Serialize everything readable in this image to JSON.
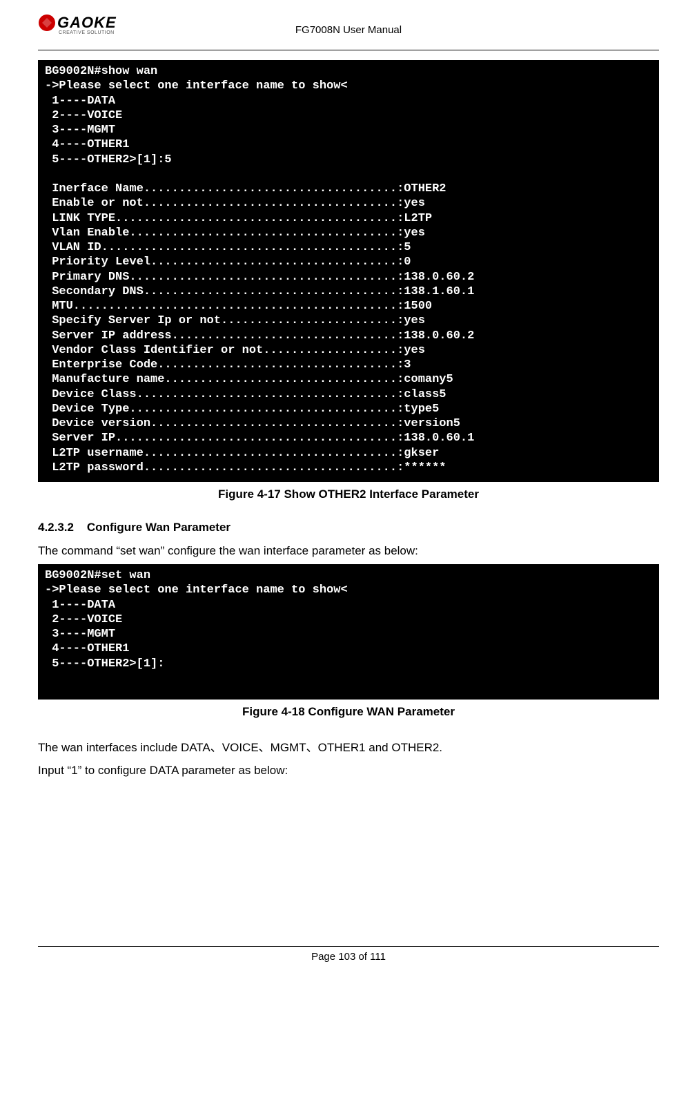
{
  "header": {
    "logo_brand": "GAOKE",
    "logo_tag": "CREATIVE SOLUTION",
    "doc_title": "FG7008N User Manual"
  },
  "terminal1": "BG9002N#show wan\n->Please select one interface name to show<\n 1----DATA\n 2----VOICE\n 3----MGMT\n 4----OTHER1\n 5----OTHER2>[1]:5\n\n Inerface Name....................................:OTHER2\n Enable or not....................................:yes\n LINK TYPE........................................:L2TP\n Vlan Enable......................................:yes\n VLAN ID..........................................:5\n Priority Level...................................:0\n Primary DNS......................................:138.0.60.2\n Secondary DNS....................................:138.1.60.1\n MTU..............................................:1500\n Specify Server Ip or not.........................:yes\n Server IP address................................:138.0.60.2\n Vendor Class Identifier or not...................:yes\n Enterprise Code..................................:3\n Manufacture name.................................:comany5\n Device Class.....................................:class5\n Device Type......................................:type5\n Device version...................................:version5\n Server IP........................................:138.0.60.1\n L2TP username....................................:gkser\n L2TP password....................................:******",
  "figure1_caption": "Figure 4-17  Show OTHER2 Interface Parameter",
  "section": {
    "number": "4.2.3.2",
    "title": "Configure Wan Parameter"
  },
  "intro_text": "The command “set wan” configure the wan interface parameter as below:",
  "terminal2": "BG9002N#set wan\n->Please select one interface name to show<\n 1----DATA\n 2----VOICE\n 3----MGMT\n 4----OTHER1\n 5----OTHER2>[1]:",
  "figure2_caption": "Figure 4-18  Configure WAN Parameter",
  "para1": "The wan interfaces include DATA、VOICE、MGMT、OTHER1 and OTHER2.",
  "para2": "Input “1” to configure DATA parameter as below:",
  "footer": "Page 103 of 111"
}
